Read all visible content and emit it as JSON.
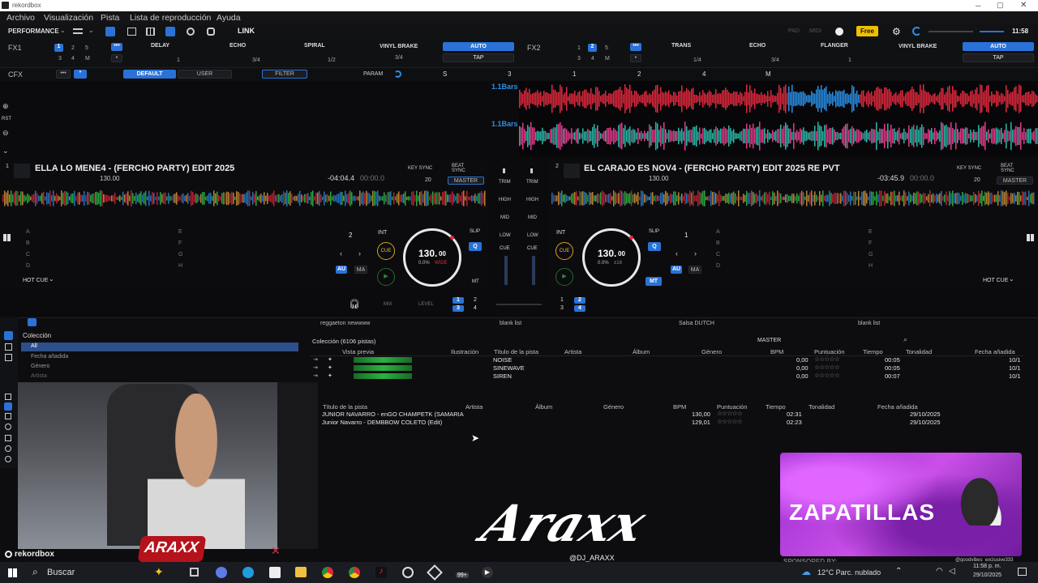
{
  "window": {
    "title": "rekordbox"
  },
  "menu": [
    "Archivo",
    "Visualización",
    "Pista",
    "Lista de reproducción",
    "Ayuda"
  ],
  "toolbar": {
    "mode": "PERFORMANCE",
    "link": "LINK",
    "ghost1": "PAD",
    "ghost2": "MIDI",
    "plan": "Free",
    "clock": "11:58"
  },
  "fx1": {
    "label": "FX1",
    "slots": [
      "DELAY",
      "ECHO",
      "SPIRAL"
    ],
    "beat": "VINYL BRAKE",
    "auto": "AUTO",
    "tap": "TAP",
    "nums": [
      "1",
      "2",
      "5",
      "3",
      "4",
      "M"
    ],
    "vals": [
      "1",
      "3/4",
      "1/2",
      "3/4"
    ]
  },
  "fx2": {
    "label": "FX2",
    "slots": [
      "TRANS",
      "ECHO",
      "FLANGER"
    ],
    "beat": "VINYL BRAKE",
    "auto": "AUTO",
    "tap": "TAP",
    "nums": [
      "1",
      "2",
      "5",
      "3",
      "4",
      "M"
    ],
    "vals": [
      "1/4",
      "3/4",
      "1"
    ]
  },
  "cfx": {
    "label": "CFX",
    "default": "DEFAULT",
    "user": "USER",
    "filter": "FILTER",
    "param": "PARAM",
    "keys": [
      "S",
      "3",
      "1",
      "2",
      "4",
      "M"
    ]
  },
  "wave": {
    "bars1": "1.1Bars",
    "bars2": "1.1Bars"
  },
  "deck1": {
    "num": "1",
    "title": "ELLA LO MENE4 - (FERCHO PARTY) EDIT 2025",
    "bpm": "130.00",
    "remain": "-04:04.4",
    "elapsed": "00:00.0",
    "keysync": "KEY SYNC",
    "beatsync": "BEAT SYNC",
    "key_off": "20",
    "master": "MASTER",
    "jog_bpm": "130.",
    "jog_dec": "00",
    "jog_pct": "0.0%",
    "jog_range": "WIDE",
    "loop": "2",
    "int": "INT",
    "cue": "CUE",
    "slip": "SLIP",
    "q": "Q",
    "au": "AU",
    "ma": "MA",
    "mt": "MT",
    "hotcue": "HOT CUE",
    "pads_l": [
      "A",
      "B",
      "C",
      "D"
    ],
    "pads_r": [
      "E",
      "F",
      "G",
      "H"
    ]
  },
  "deck2": {
    "num": "2",
    "title": "EL CARAJO ES NOV4 - (FERCHO PARTY) EDIT 2025 RE PVT",
    "bpm": "130.00",
    "remain": "-03:45.9",
    "elapsed": "00:00.0",
    "keysync": "KEY SYNC",
    "beatsync": "BEAT SYNC",
    "key_off": "20",
    "master": "MASTER",
    "jog_bpm": "130.",
    "jog_dec": "00",
    "jog_pct": "0.0%",
    "jog_range": "±16",
    "loop": "1",
    "int": "INT",
    "cue": "CUE",
    "slip": "SLIP",
    "q": "Q",
    "au": "AU",
    "ma": "MA",
    "mt": "MT",
    "hotcue": "HOT CUE",
    "pads_l": [
      "A",
      "B",
      "C",
      "D"
    ],
    "pads_r": [
      "E",
      "F",
      "G",
      "H"
    ]
  },
  "mixer": {
    "trim": "TRIM",
    "high": "HIGH",
    "mid": "MID",
    "low": "LOW",
    "cue": "CUE",
    "mix": "MIX",
    "level": "LEVEL",
    "ch": [
      "1",
      "2",
      "3",
      "4"
    ]
  },
  "browser": {
    "tree": {
      "root": "Colección",
      "items": [
        "All",
        "Fecha añadida",
        "Género",
        "Artista"
      ]
    },
    "tabs": [
      "reggaeton newwww",
      "blank list",
      "Salsa DUTCH",
      "blank list"
    ],
    "collection": "Colección (6106 pistas)",
    "master": "MASTER",
    "columns": [
      "Vista previa",
      "Ilustración",
      "Título de la pista",
      "Artista",
      "Álbum",
      "Género",
      "BPM",
      "Puntuación",
      "Tiempo",
      "Tonalidad",
      "Fecha añadida"
    ],
    "rows": [
      {
        "title": "NOISE",
        "bpm": "0,00",
        "time": "00:05",
        "date": "10/1"
      },
      {
        "title": "SINEWAVE",
        "bpm": "0,00",
        "time": "00:05",
        "date": "10/1"
      },
      {
        "title": "SIREN",
        "bpm": "0,00",
        "time": "00:07",
        "date": "10/1"
      }
    ],
    "columns2": [
      "Título de la pista",
      "Artista",
      "Álbum",
      "Género",
      "BPM",
      "Puntuación",
      "Tiempo",
      "Tonalidad",
      "Fecha añadida"
    ],
    "rows2": [
      {
        "title": "JUNIOR NAVARRO - enGO CHAMPETK (SAMARIA",
        "bpm": "130,00",
        "time": "02:31",
        "date": "29/10/2025"
      },
      {
        "title": "Junior Navarro - DEMBBOW COLETO (Edit)",
        "bpm": "129,01",
        "time": "02:23",
        "date": "29/10/2025"
      }
    ]
  },
  "overlay": {
    "brand": "rekordbox",
    "logo": "ARAXX",
    "sig": "Araxx",
    "handle": "@DJ_ARAXX",
    "promo": "ZAPATILLAS",
    "sponsor": "SPONSORED BY:",
    "promo_handle": "@goodvibes_exclusive333"
  },
  "taskbar": {
    "search": "Buscar",
    "badge": "99+",
    "weather": "12°C  Parc. nublado",
    "time": "11:58 p. m.",
    "date": "29/10/2025"
  },
  "colors": {
    "accent": "#2a72d8",
    "wave_red": "#e0283c",
    "wave_blue": "#2a8fe6",
    "promo": "#b43ad6",
    "free": "#f0c000"
  }
}
